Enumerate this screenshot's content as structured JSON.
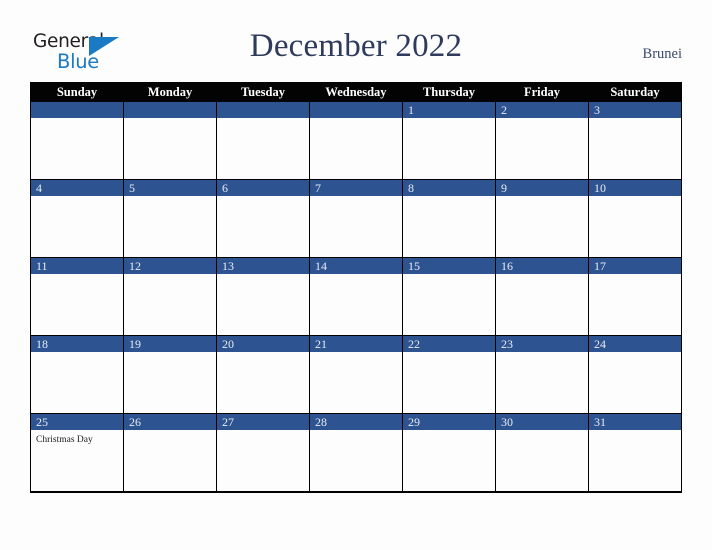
{
  "brand": {
    "name_part1": "General",
    "name_part2": "Blue",
    "triangle_icon": "triangle-icon",
    "color_primary": "#1a7ac4",
    "color_text": "#231f20"
  },
  "header": {
    "title": "December 2022",
    "country": "Brunei",
    "title_color": "#2f3b5c",
    "country_color": "#3b4a6b"
  },
  "calendar": {
    "weekday_headers": [
      "Sunday",
      "Monday",
      "Tuesday",
      "Wednesday",
      "Thursday",
      "Friday",
      "Saturday"
    ],
    "header_bg": "#030303",
    "header_text_color": "#ffffff",
    "daybar_bg": "#2d5391",
    "daybar_text_color": "#e8ecf3",
    "cell_bg": "#fdfdfd",
    "border_color": "#000000",
    "weeks": [
      [
        {
          "date": "",
          "events": []
        },
        {
          "date": "",
          "events": []
        },
        {
          "date": "",
          "events": []
        },
        {
          "date": "",
          "events": []
        },
        {
          "date": "1",
          "events": []
        },
        {
          "date": "2",
          "events": []
        },
        {
          "date": "3",
          "events": []
        }
      ],
      [
        {
          "date": "4",
          "events": []
        },
        {
          "date": "5",
          "events": []
        },
        {
          "date": "6",
          "events": []
        },
        {
          "date": "7",
          "events": []
        },
        {
          "date": "8",
          "events": []
        },
        {
          "date": "9",
          "events": []
        },
        {
          "date": "10",
          "events": []
        }
      ],
      [
        {
          "date": "11",
          "events": []
        },
        {
          "date": "12",
          "events": []
        },
        {
          "date": "13",
          "events": []
        },
        {
          "date": "14",
          "events": []
        },
        {
          "date": "15",
          "events": []
        },
        {
          "date": "16",
          "events": []
        },
        {
          "date": "17",
          "events": []
        }
      ],
      [
        {
          "date": "18",
          "events": []
        },
        {
          "date": "19",
          "events": []
        },
        {
          "date": "20",
          "events": []
        },
        {
          "date": "21",
          "events": []
        },
        {
          "date": "22",
          "events": []
        },
        {
          "date": "23",
          "events": []
        },
        {
          "date": "24",
          "events": []
        }
      ],
      [
        {
          "date": "25",
          "events": [
            "Christmas Day"
          ]
        },
        {
          "date": "26",
          "events": []
        },
        {
          "date": "27",
          "events": []
        },
        {
          "date": "28",
          "events": []
        },
        {
          "date": "29",
          "events": []
        },
        {
          "date": "30",
          "events": []
        },
        {
          "date": "31",
          "events": []
        }
      ]
    ]
  }
}
